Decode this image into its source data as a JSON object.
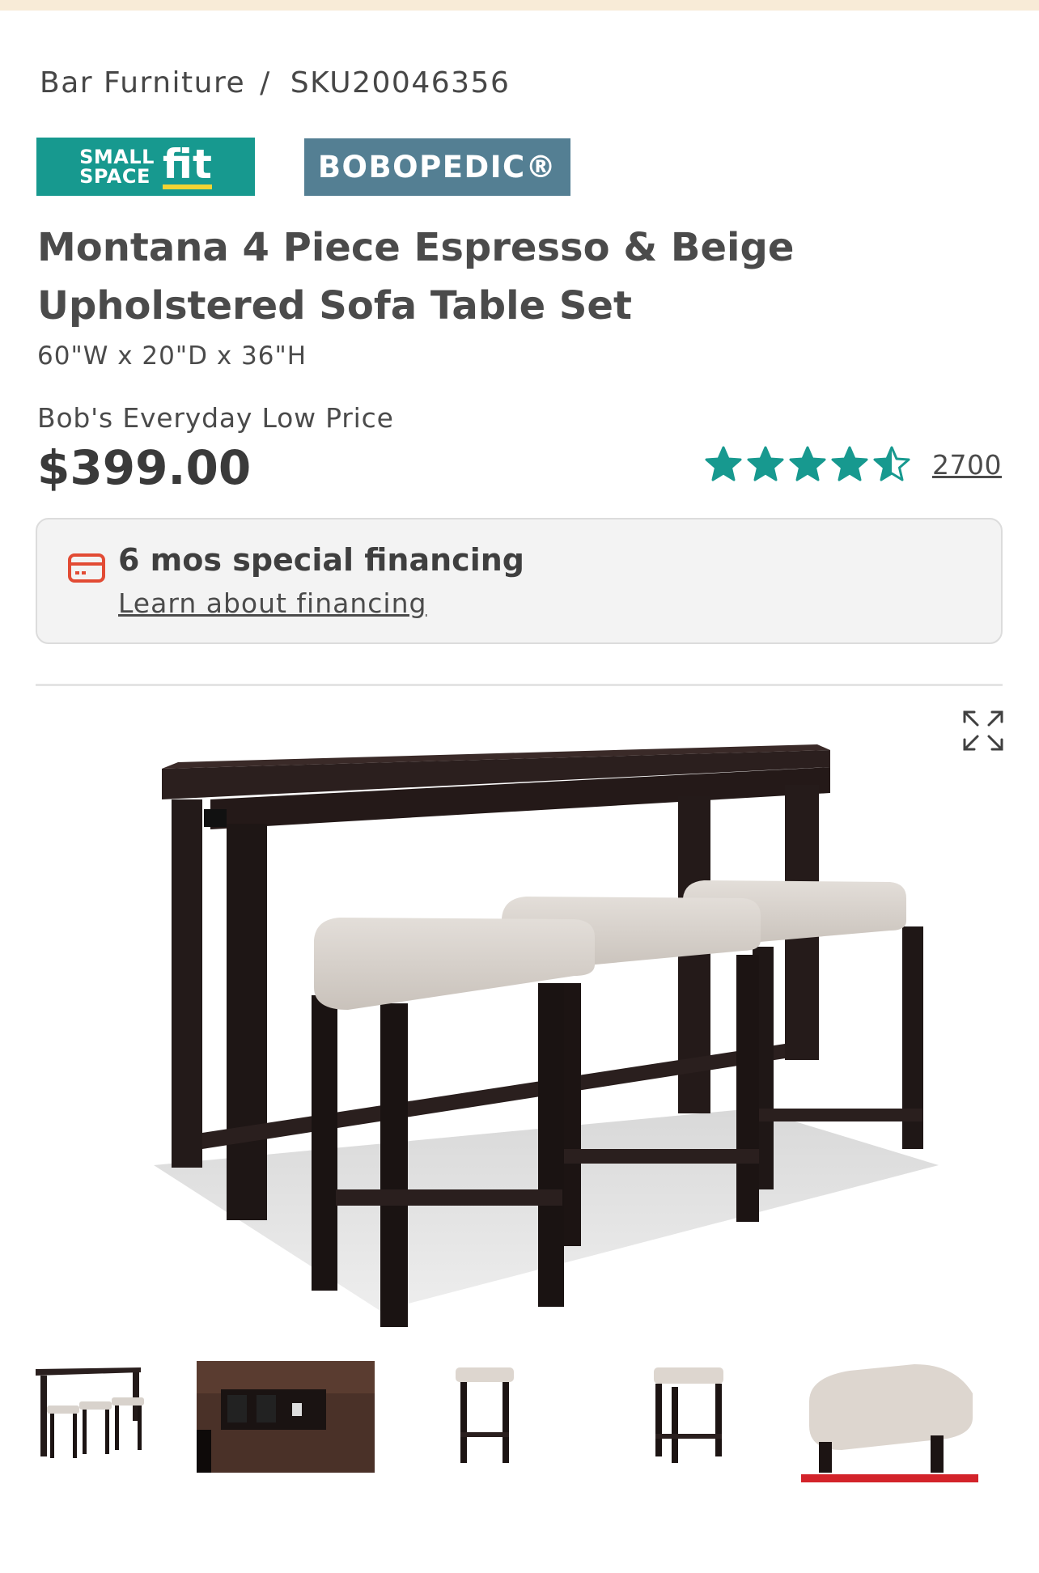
{
  "breadcrumb": {
    "category": "Bar Furniture",
    "separator": "/",
    "sku": "SKU20046356"
  },
  "badges": {
    "small_space": {
      "line1": "SMALL",
      "line2": "SPACE",
      "word": "fit"
    },
    "bobopedic": {
      "text": "BOBOPEDIC®"
    }
  },
  "product": {
    "title": "Montana 4 Piece Espresso & Beige Upholstered Sofa Table Set",
    "dimensions": "60\"W x 20\"D x 36\"H",
    "price_label": "Bob's Everyday Low Price",
    "price": "$399.00"
  },
  "rating": {
    "stars": 4.5,
    "max_stars": 5,
    "review_count": "2700"
  },
  "financing": {
    "headline": "6 mos special financing",
    "link": "Learn about financing"
  },
  "gallery": {
    "thumbnails": [
      {
        "name": "full-set-view"
      },
      {
        "name": "power-outlet-closeup"
      },
      {
        "name": "stool-front-view"
      },
      {
        "name": "stool-angle-view"
      },
      {
        "name": "seat-closeup"
      }
    ],
    "selected_index": 4
  },
  "colors": {
    "teal_star": "#17998f",
    "small_space_badge": "#17998f",
    "bobopedic_badge": "#547f93",
    "selected_underline": "#d3232a",
    "card_icon": "#e24b34",
    "top_strip": "#f8ebd7"
  },
  "icons": {
    "expand": "expand-icon",
    "financing": "credit-card-icon",
    "star": "star-icon"
  }
}
